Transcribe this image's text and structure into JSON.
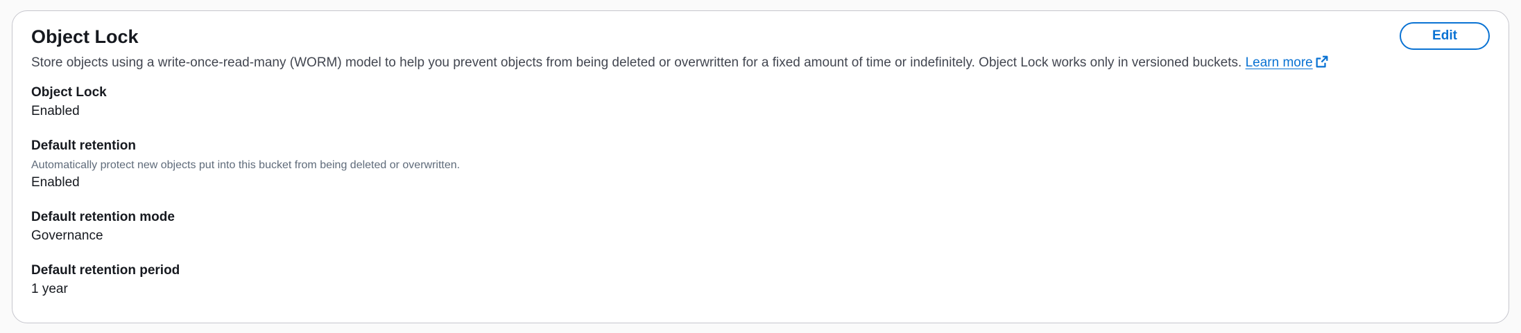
{
  "panel": {
    "title": "Object Lock",
    "description": "Store objects using a write-once-read-many (WORM) model to help you prevent objects from being deleted or overwritten for a fixed amount of time or indefinitely. Object Lock works only in versioned buckets.",
    "learn_more": "Learn more",
    "edit_label": "Edit"
  },
  "fields": {
    "object_lock": {
      "label": "Object Lock",
      "value": "Enabled"
    },
    "default_retention": {
      "label": "Default retention",
      "hint": "Automatically protect new objects put into this bucket from being deleted or overwritten.",
      "value": "Enabled"
    },
    "default_retention_mode": {
      "label": "Default retention mode",
      "value": "Governance"
    },
    "default_retention_period": {
      "label": "Default retention period",
      "value": "1 year"
    }
  },
  "colors": {
    "accent": "#0972d3",
    "text": "#16191f",
    "secondary_text": "#5f6b7a",
    "border": "#c6c6cd"
  },
  "icons": {
    "external_link": "external-link-icon"
  }
}
